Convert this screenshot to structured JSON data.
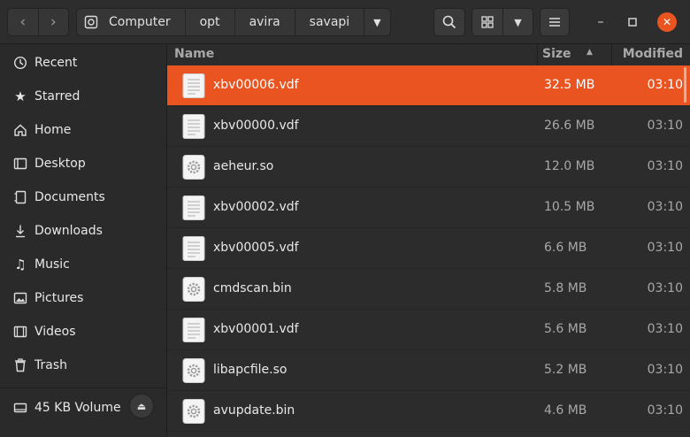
{
  "breadcrumb": [
    "Computer",
    "opt",
    "avira",
    "savapi"
  ],
  "sidebar": {
    "items": [
      {
        "label": "Recent",
        "icon": "clock-icon"
      },
      {
        "label": "Starred",
        "icon": "star-icon"
      },
      {
        "label": "Home",
        "icon": "home-icon"
      },
      {
        "label": "Desktop",
        "icon": "desktop-icon"
      },
      {
        "label": "Documents",
        "icon": "documents-icon"
      },
      {
        "label": "Downloads",
        "icon": "downloads-icon"
      },
      {
        "label": "Music",
        "icon": "music-icon"
      },
      {
        "label": "Pictures",
        "icon": "pictures-icon"
      },
      {
        "label": "Videos",
        "icon": "videos-icon"
      },
      {
        "label": "Trash",
        "icon": "trash-icon"
      }
    ],
    "volume": {
      "label": "45 KB Volume",
      "icon": "drive-icon"
    }
  },
  "columns": {
    "name": "Name",
    "size": "Size",
    "modified": "Modified"
  },
  "files": [
    {
      "name": "xbv00006.vdf",
      "size": "32.5 MB",
      "modified": "03:10",
      "type": "document",
      "selected": true
    },
    {
      "name": "xbv00000.vdf",
      "size": "26.6 MB",
      "modified": "03:10",
      "type": "document",
      "selected": false
    },
    {
      "name": "aeheur.so",
      "size": "12.0 MB",
      "modified": "03:10",
      "type": "library",
      "selected": false
    },
    {
      "name": "xbv00002.vdf",
      "size": "10.5 MB",
      "modified": "03:10",
      "type": "document",
      "selected": false
    },
    {
      "name": "xbv00005.vdf",
      "size": "6.6 MB",
      "modified": "03:10",
      "type": "document",
      "selected": false
    },
    {
      "name": "cmdscan.bin",
      "size": "5.8 MB",
      "modified": "03:10",
      "type": "library",
      "selected": false
    },
    {
      "name": "xbv00001.vdf",
      "size": "5.6 MB",
      "modified": "03:10",
      "type": "document",
      "selected": false
    },
    {
      "name": "libapcfile.so",
      "size": "5.2 MB",
      "modified": "03:10",
      "type": "library",
      "selected": false
    },
    {
      "name": "avupdate.bin",
      "size": "4.6 MB",
      "modified": "03:10",
      "type": "library",
      "selected": false
    }
  ],
  "colors": {
    "accent": "#e95420",
    "background": "#2c2c2c",
    "sidebar": "#2a2a2a"
  }
}
